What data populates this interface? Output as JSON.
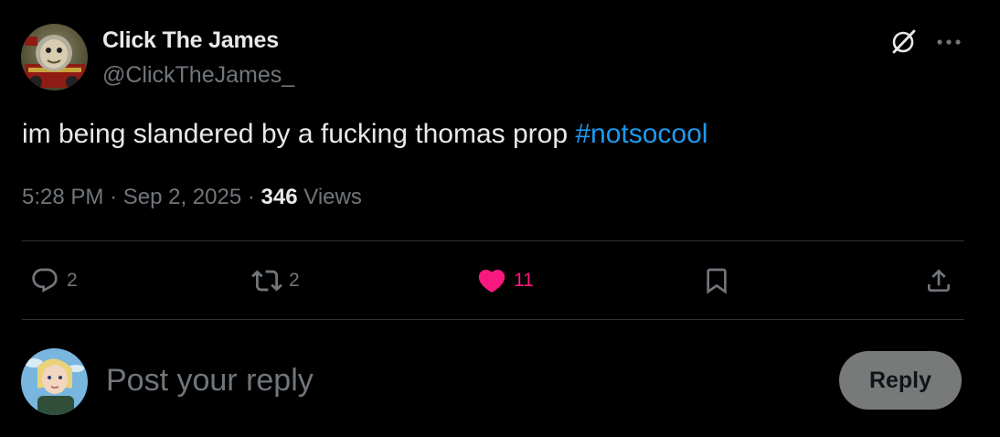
{
  "author": {
    "name": "Click The James",
    "handle": "@ClickTheJames_"
  },
  "post": {
    "text": "im being slandered by a fucking thomas prop ",
    "hashtag": "#notsocool",
    "time": "5:28 PM",
    "separator": "·",
    "date": "Sep 2, 2025",
    "views_count": "346",
    "views_label": "Views"
  },
  "actions": {
    "replies": "2",
    "reposts": "2",
    "likes": "11"
  },
  "composer": {
    "placeholder": "Post your reply",
    "reply_label": "Reply"
  },
  "icons": {
    "grok": "grok-icon",
    "more": "more-icon",
    "reply": "reply-icon",
    "repost": "repost-icon",
    "like": "heart-icon",
    "bookmark": "bookmark-icon",
    "share": "share-icon"
  },
  "colors": {
    "background": "#000000",
    "text_primary": "#e7e9ea",
    "text_secondary": "#71767b",
    "link": "#1d9bf0",
    "like_active": "#f91880",
    "divider": "#2f3336",
    "reply_button_disabled": "#787a7a"
  }
}
